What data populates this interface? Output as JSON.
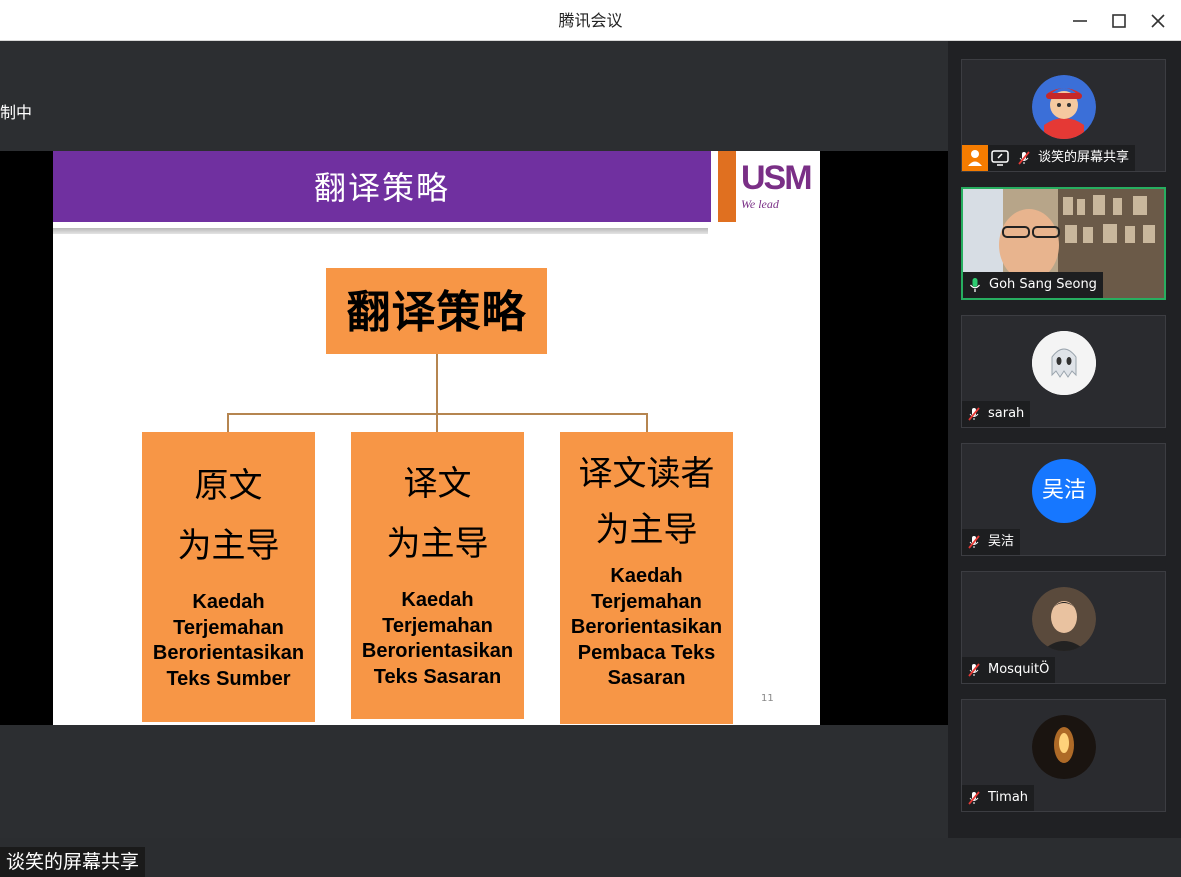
{
  "window": {
    "title": "腾讯会议"
  },
  "status_text": "制中",
  "slide": {
    "header_title": "翻译策略",
    "logo_text": "USM",
    "logo_tagline": "We lead",
    "root_label": "翻译策略",
    "boxes": [
      {
        "cn_line1": "原文",
        "cn_line2": "为主导",
        "ms_lines": [
          "Kaedah",
          "Terjemahan",
          "Berorientasikan",
          "Teks Sumber"
        ]
      },
      {
        "cn_line1": "译文",
        "cn_line2": "为主导",
        "ms_lines": [
          "Kaedah",
          "Terjemahan",
          "Berorientasikan",
          "Teks Sasaran"
        ]
      },
      {
        "cn_line1": "译文读者",
        "cn_line2": "为主导",
        "ms_lines": [
          "Kaedah",
          "Terjemahan",
          "Berorientasikan",
          "Pembaca Teks",
          "Sasaran"
        ]
      }
    ],
    "page_number": "11"
  },
  "share_label": "谈笑的屏幕共享",
  "participants": [
    {
      "name": "谈笑的屏幕共享",
      "mic": "muted",
      "avatar": "cartoon-avatar"
    },
    {
      "name": "Goh Sang Seong",
      "mic": "active",
      "avatar": "video-feed"
    },
    {
      "name": "sarah",
      "mic": "muted",
      "avatar": "ghost-avatar"
    },
    {
      "name": "吴洁",
      "mic": "muted",
      "avatar": "text-avatar",
      "avatar_text": "吴洁"
    },
    {
      "name": "MosquitÖ",
      "mic": "muted",
      "avatar": "photo-avatar"
    },
    {
      "name": "Timah",
      "mic": "muted",
      "avatar": "photo-avatar"
    }
  ],
  "colors": {
    "header_purple": "#7030a0",
    "box_orange": "#f79646",
    "active_green": "#27ae60",
    "text_avatar_blue": "#1677ff"
  }
}
